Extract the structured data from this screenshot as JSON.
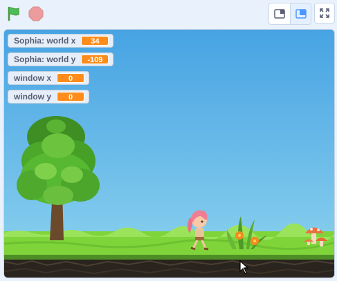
{
  "controls": {
    "green_flag_icon": "green-flag-icon",
    "stop_icon": "stop-sign-icon"
  },
  "stage_modes": [
    "small-stage-icon",
    "normal-stage-icon",
    "fullscreen-icon"
  ],
  "monitors": [
    {
      "label": "Sophia: world x",
      "value": "34"
    },
    {
      "label": "Sophia: world y",
      "value": "-109"
    },
    {
      "label": "window x",
      "value": "0"
    },
    {
      "label": "window y",
      "value": "0"
    }
  ],
  "colors": {
    "sky_top": "#47a3e3",
    "sky_bottom": "#8fd4ef",
    "grass": "#7fd43a",
    "soil": "#2a241e",
    "monitor_value": "#ff8c1a"
  }
}
